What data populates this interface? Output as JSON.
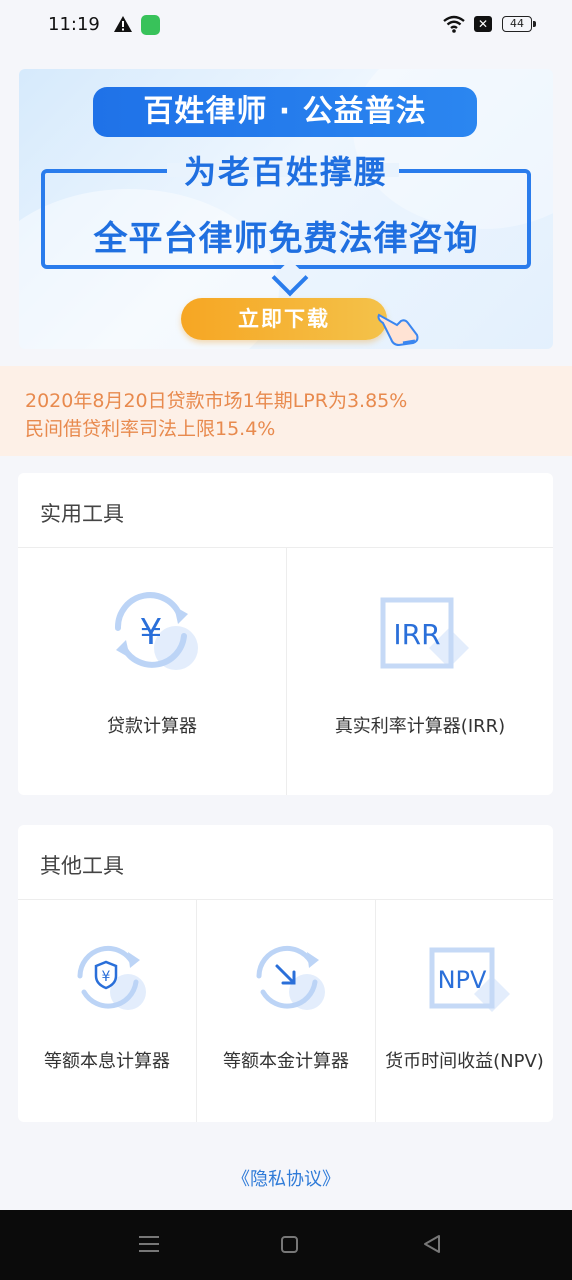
{
  "status_bar": {
    "time": "11:19",
    "battery": "44",
    "icons": [
      "warning-icon",
      "app-notification-icon",
      "wifi-icon",
      "close-box-icon",
      "battery-icon"
    ]
  },
  "banner": {
    "headline": "百姓律师 · 公益普法",
    "subtitle": "为老百姓撑腰",
    "main_text": "全平台律师免费法律咨询",
    "button_label": "立即下载"
  },
  "notice": {
    "line1": "2020年8月20日贷款市场1年期LPR为3.85%",
    "line2": "民间借贷利率司法上限15.4%"
  },
  "practical_tools": {
    "title": "实用工具",
    "items": [
      {
        "label": "贷款计算器",
        "icon": "yen-refresh-icon"
      },
      {
        "label": "真实利率计算器(IRR)",
        "icon_text": "IRR",
        "icon": "irr-icon"
      }
    ]
  },
  "other_tools": {
    "title": "其他工具",
    "items": [
      {
        "label": "等额本息计算器",
        "icon": "yen-shield-refresh-icon"
      },
      {
        "label": "等额本金计算器",
        "icon": "arrow-down-right-refresh-icon"
      },
      {
        "label": "货币时间收益(NPV)",
        "icon_text": "NPV",
        "icon": "npv-icon"
      }
    ]
  },
  "footer": {
    "privacy_link": "《隐私协议》"
  },
  "colors": {
    "accent": "#2a7cec",
    "notice_text": "#e88a4e",
    "button": "#f6a623"
  }
}
